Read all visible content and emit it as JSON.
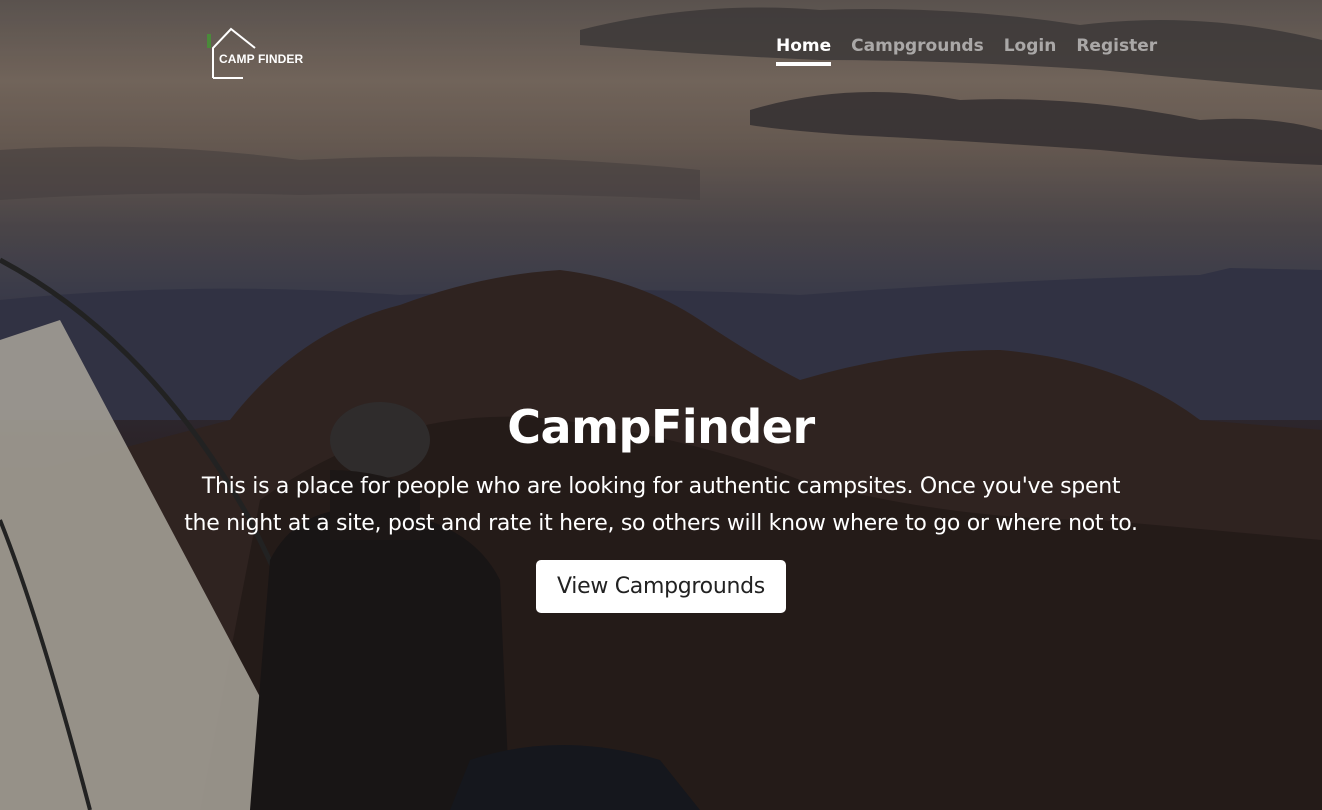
{
  "brand": {
    "logo_text": "CAMP FINDER"
  },
  "nav": {
    "items": [
      {
        "label": "Home",
        "active": true
      },
      {
        "label": "Campgrounds",
        "active": false
      },
      {
        "label": "Login",
        "active": false
      },
      {
        "label": "Register",
        "active": false
      }
    ]
  },
  "hero": {
    "title": "CampFinder",
    "lead": "This is a place for people who are looking for authentic campsites. Once you've spent the night at a site, post and rate it here, so others will know where to go or where not to.",
    "button_label": "View Campgrounds"
  },
  "colors": {
    "text": "#ffffff",
    "button_bg": "#ffffff",
    "button_text": "#222222",
    "logo_accent": "#4a8a3a"
  },
  "icons": {
    "logo": "house-outline-icon"
  }
}
